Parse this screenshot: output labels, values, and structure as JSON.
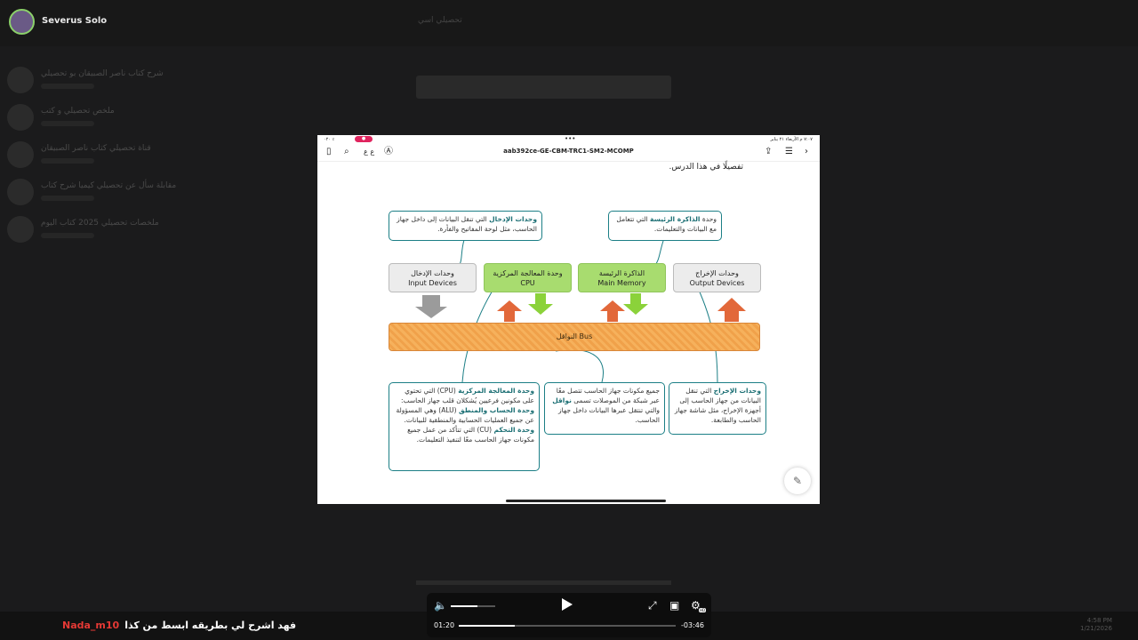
{
  "background": {
    "user_name": "Severus Solo",
    "chats": [
      {
        "title": "شرح كتاب ناصر الصبيقان بو تحصيلي"
      },
      {
        "title": "ملخص تحصيلي و كتب"
      },
      {
        "title": "قناة تحصيلي كتاب ناصر الصبيقان"
      },
      {
        "title": "مقابلة سأل عن تحصيلي كيميا شرح كتاب"
      },
      {
        "title": "ملخصات تحصيلي 2025 كتاب اليوم"
      }
    ],
    "top_title": "تحصيلي اسي",
    "time": "4:58 PM",
    "date": "1/21/2026"
  },
  "viewer": {
    "status_left": "·٢٠ ٪",
    "status_rec": "●",
    "status_dots": "•••",
    "status_right": "٧:٠٧ م  الأربعاء ٢١ يناير",
    "doc_title": "aab392ce-GE-CBM-TRC1-SM2-MCOMP",
    "icons": {
      "bookmark": "bookmark-icon",
      "search": "search-icon",
      "a11y": "accessibility-icon",
      "share": "share-icon",
      "list": "list-icon",
      "forward": "chevron-right-icon"
    },
    "tb_aa": "ع ع",
    "page_text": "تفصيلًا في هذا الدرس."
  },
  "diagram": {
    "input_desc_bold": "وحدات الإدخال",
    "input_desc": " التي تنقل البيانات إلى داخل جهاز الحاسب، مثل لوحة المفاتيح والفأرة.",
    "memory_desc_pre": "وحدة ",
    "memory_desc_bold": "الذاكرة الرئيسة",
    "memory_desc": " التي تتعامل مع البيانات والتعليمات.",
    "input_ar": "وحدات الإدخال",
    "input_en": "Input Devices",
    "cpu_ar": "وحدة المعالجة المركزية",
    "cpu_en": "CPU",
    "mem_ar": "الذاكرة الرئيسة",
    "mem_en": "Main Memory",
    "output_ar": "وحدات الإخراج",
    "output_en": "Output Devices",
    "bus_label": "النواقل Bus",
    "cpu_desc_bold1": "وحدة المعالجة المركزية",
    "cpu_desc_1": " (CPU) التي تحتوي على مكونين فرعيين يُشكلان قلب جهاز الحاسب: ",
    "cpu_desc_bold2": "وحدة الحساب والمنطق",
    "cpu_desc_2": " (ALU) وهي المسؤولة عن جميع العمليات الحسابية والمنطقية للبيانات. ",
    "cpu_desc_bold3": "وحدة التحكم",
    "cpu_desc_3": " (CU) التي تتأكد من عمل جميع مكونات جهاز الحاسب معًا لتنفيذ التعليمات.",
    "bus_desc_1": "جميع مكونات جهاز الحاسب تتصل معًا عبر شبكة من الموصلات تسمى ",
    "bus_desc_bold": "نواقل",
    "bus_desc_2": " والتي تنتقل عبرها البيانات داخل جهاز الحاسب.",
    "output_desc_bold": "وحدات الإخراج",
    "output_desc": " التي تنقل البيانات من جهاز الحاسب إلى أجهزة الإخراج، مثل شاشة جهاز الحاسب والطابعة."
  },
  "player": {
    "current_time": "01:20",
    "remaining_time": "-03:46",
    "progress": 0.26,
    "volume": 0.6,
    "hd_badge": "HD",
    "icons": {
      "volume": "volume-icon",
      "play": "play-icon",
      "fullscreen": "fullscreen-icon",
      "pip": "pip-icon",
      "settings": "gear-icon"
    }
  },
  "caption": {
    "user": "Nada_m10",
    "message": "فهد اشرح لي بطريقه ابسط من كذا"
  },
  "colors": {
    "teal": "#1c7f86",
    "green": "#a8dc6f",
    "orange": "#f0a14a",
    "grey_arrow": "#9b9b9b",
    "green_arrow": "#8bd23a",
    "red_arrow": "#e2683a",
    "rec_badge": "#e0245e",
    "caption_user": "#e53935"
  }
}
